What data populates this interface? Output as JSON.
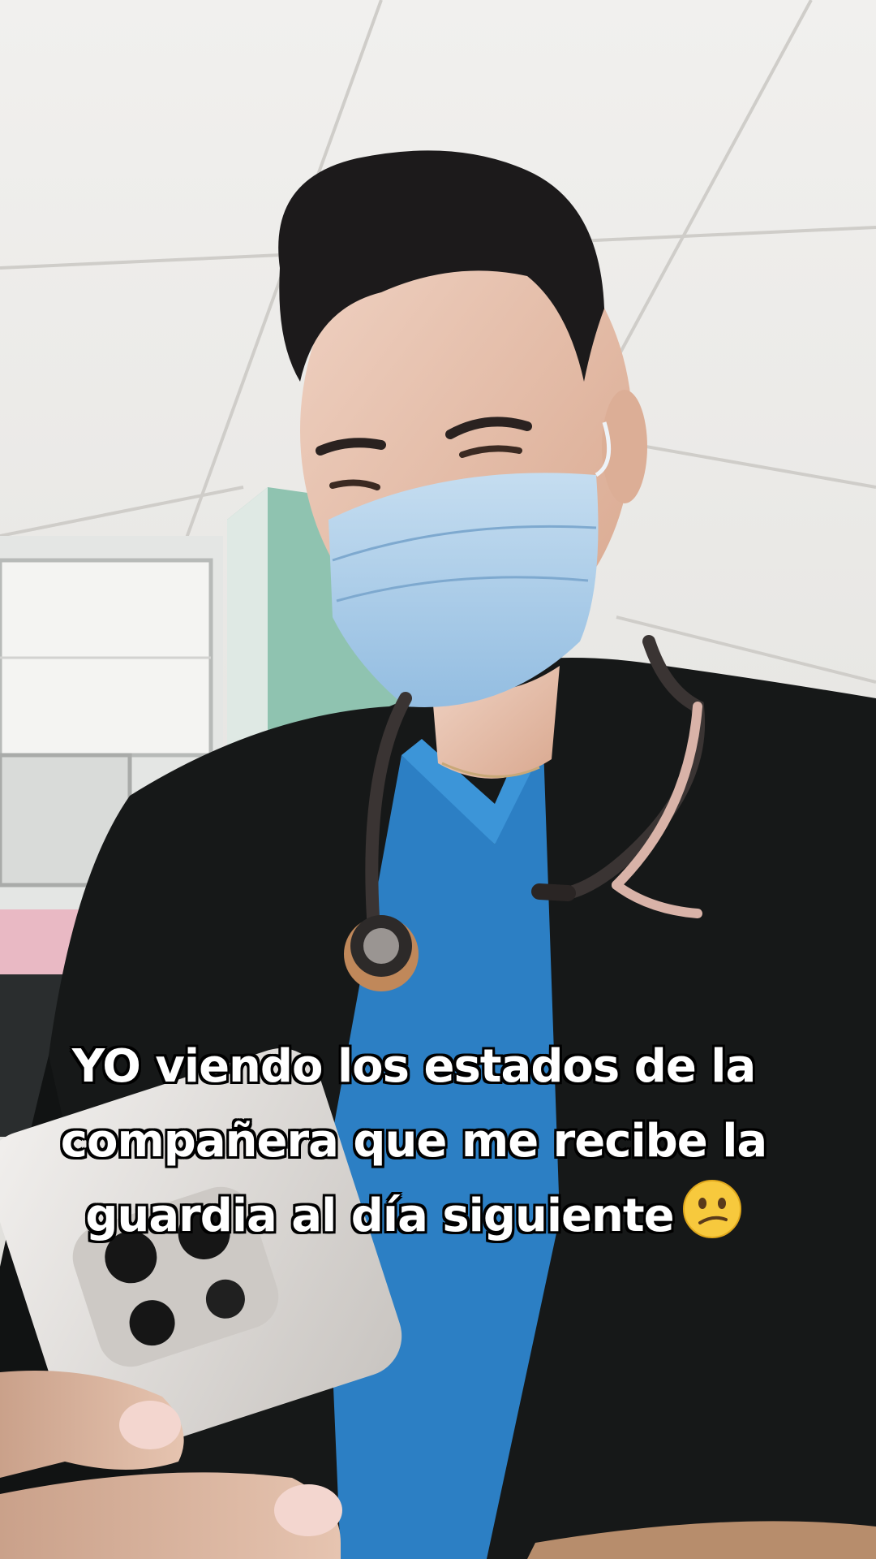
{
  "caption": {
    "line1": "YO viendo los estados de la",
    "line2": "compañera que me recibe la",
    "line3": "guardia al día siguiente",
    "emoji": "confused-face-emoji"
  },
  "colors": {
    "ceiling": "#ecebe8",
    "wall": "#8fc3b0",
    "scrubs": "#2c7fc4",
    "mask": "#a9cde8",
    "jacket": "#161818",
    "phone": "#dcd9d6"
  }
}
